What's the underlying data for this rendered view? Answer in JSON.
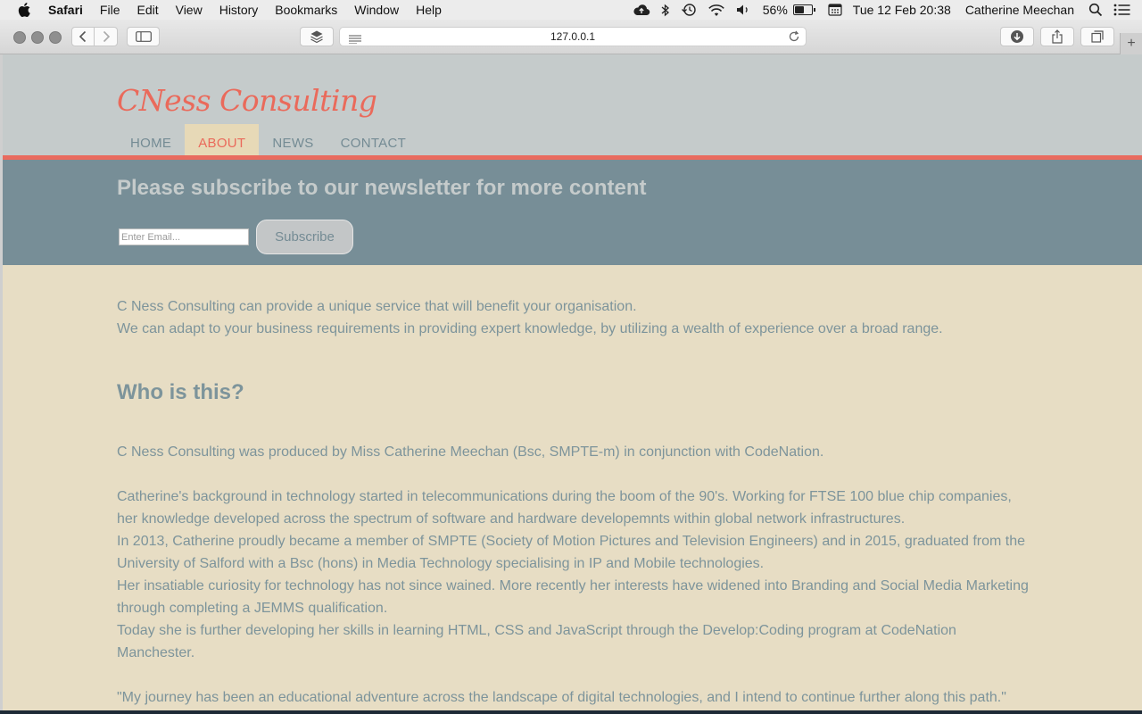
{
  "menubar": {
    "app_name": "Safari",
    "items": [
      "File",
      "Edit",
      "View",
      "History",
      "Bookmarks",
      "Window",
      "Help"
    ],
    "battery_percent": "56%",
    "battery_level": 0.56,
    "datetime": "Tue 12 Feb  20:38",
    "user_name": "Catherine Meechan"
  },
  "browser": {
    "url": "127.0.0.1"
  },
  "site": {
    "logo": "CNess Consulting",
    "nav": [
      {
        "label": "HOME",
        "active": false
      },
      {
        "label": "ABOUT",
        "active": true
      },
      {
        "label": "NEWS",
        "active": false
      },
      {
        "label": "CONTACT",
        "active": false
      }
    ],
    "subscribe": {
      "title": "Please subscribe to our newsletter for more content",
      "email_placeholder": "Enter Email...",
      "button_label": "Subscribe"
    },
    "intro": [
      "C Ness Consulting can provide a unique service that will benefit your organisation.",
      "We can adapt to your business requirements in providing expert knowledge, by utilizing a wealth of experience over a broad range."
    ],
    "heading": "Who is this?",
    "produced_by": "C Ness Consulting was produced by Miss Catherine Meechan (Bsc, SMPTE-m) in conjunction with CodeNation.",
    "bio": [
      "Catherine's background in technology started in telecommunications during the boom of the 90's. Working for FTSE 100 blue chip companies, her knowledge developed across the spectrum of software and hardware developemnts within global network infrastructures.",
      "In 2013, Catherine proudly became a member of SMPTE (Society of Motion Pictures and Television Engineers) and in 2015, graduated from the University of Salford with a Bsc (hons) in Media Technology specialising in IP and Mobile technologies.",
      "Her insatiable curiosity for technology has not since wained. More recently her interests have widened into Branding and Social Media Marketing through completing a JEMMS qualification.",
      "Today she is further developing her skills in learning HTML, CSS and JavaScript through the Develop:Coding program at CodeNation Manchester."
    ],
    "quote": "\"My journey has been an educational adventure across the landscape of digital technologies, and I intend to continue further along this path.\""
  },
  "colors": {
    "accent": "#ea6a5b",
    "header_bg": "#c5cbcb",
    "band_bg": "#778e97",
    "page_bg": "#e7ddc4",
    "text": "#7d949b"
  }
}
